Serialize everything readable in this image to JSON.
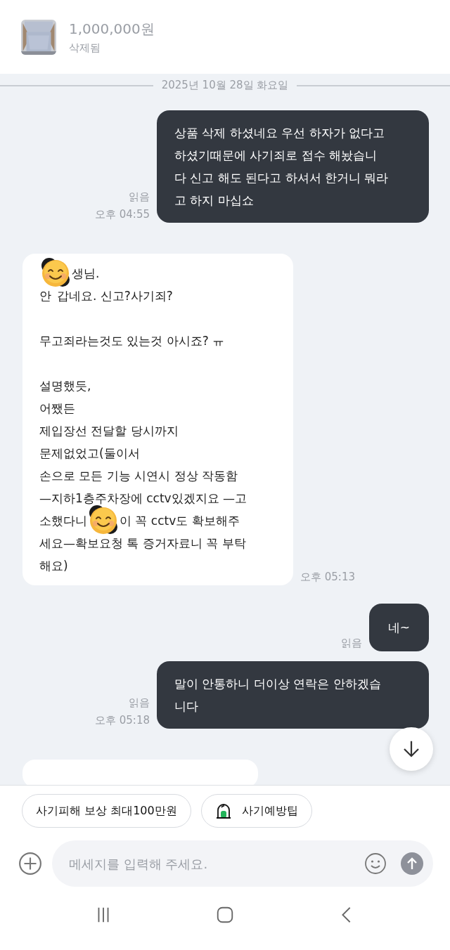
{
  "product": {
    "price": "1,000,000원",
    "status": "삭제됨"
  },
  "date": "2025년 10월 28일 화요일",
  "messages": [
    {
      "kind": "sent",
      "lines": [
        "상품 삭제 하셨네요 우선 하자가 없다고",
        "하셨기때문에 사기죄로 접수 해놨습니",
        "다 신고 해도 된다고 하셔서 한거니 뭐라",
        "고 하지 마십쇼"
      ],
      "read": "읽음",
      "time": "오후 04:55"
    },
    {
      "kind": "received",
      "paragraphs": [
        [
          [
            {
              "kind": "sticker"
            },
            {
              "kind": "text",
              "text": "생님."
            }
          ],
          [
            {
              "kind": "text",
              "text": "안"
            },
            {
              "kind": "gap"
            },
            {
              "kind": "text",
              "text": "갑네요. 신고?사기죄?"
            }
          ]
        ],
        [
          "무고죄라는것도 있는것 아시죠? ㅠ"
        ],
        [
          "설명했듯,",
          "어쨌든",
          "제입장선 전달할 당시까지",
          "문제없었고(둘이서",
          "손으로 모든  기능 시연시 정상 작동함",
          "—지하1층주차장에 cctv있겠지요 —고",
          [
            {
              "kind": "text",
              "text": "소했다니"
            },
            {
              "kind": "sticker"
            },
            {
              "kind": "text",
              "text": "이 꼭 cctv도 확보해주"
            }
          ],
          "세요—확보요청  톡 증거자료니 꼭 부탁",
          "해요)"
        ]
      ],
      "time": "오후 05:13"
    },
    {
      "kind": "sent",
      "lines": [
        "네~"
      ],
      "read": "읽음"
    },
    {
      "kind": "sent",
      "lines": [
        "말이 안통하니 더이상 연락은 안하겠습",
        "니다"
      ],
      "read": "읽음",
      "time": "오후 05:18"
    }
  ],
  "chips": [
    {
      "kind": "plain",
      "label": "사기피해 보상 최대100만원"
    },
    {
      "kind": "tip",
      "label": "사기예방팁"
    }
  ],
  "input": {
    "placeholder": "메세지를 입력해 주세요."
  }
}
